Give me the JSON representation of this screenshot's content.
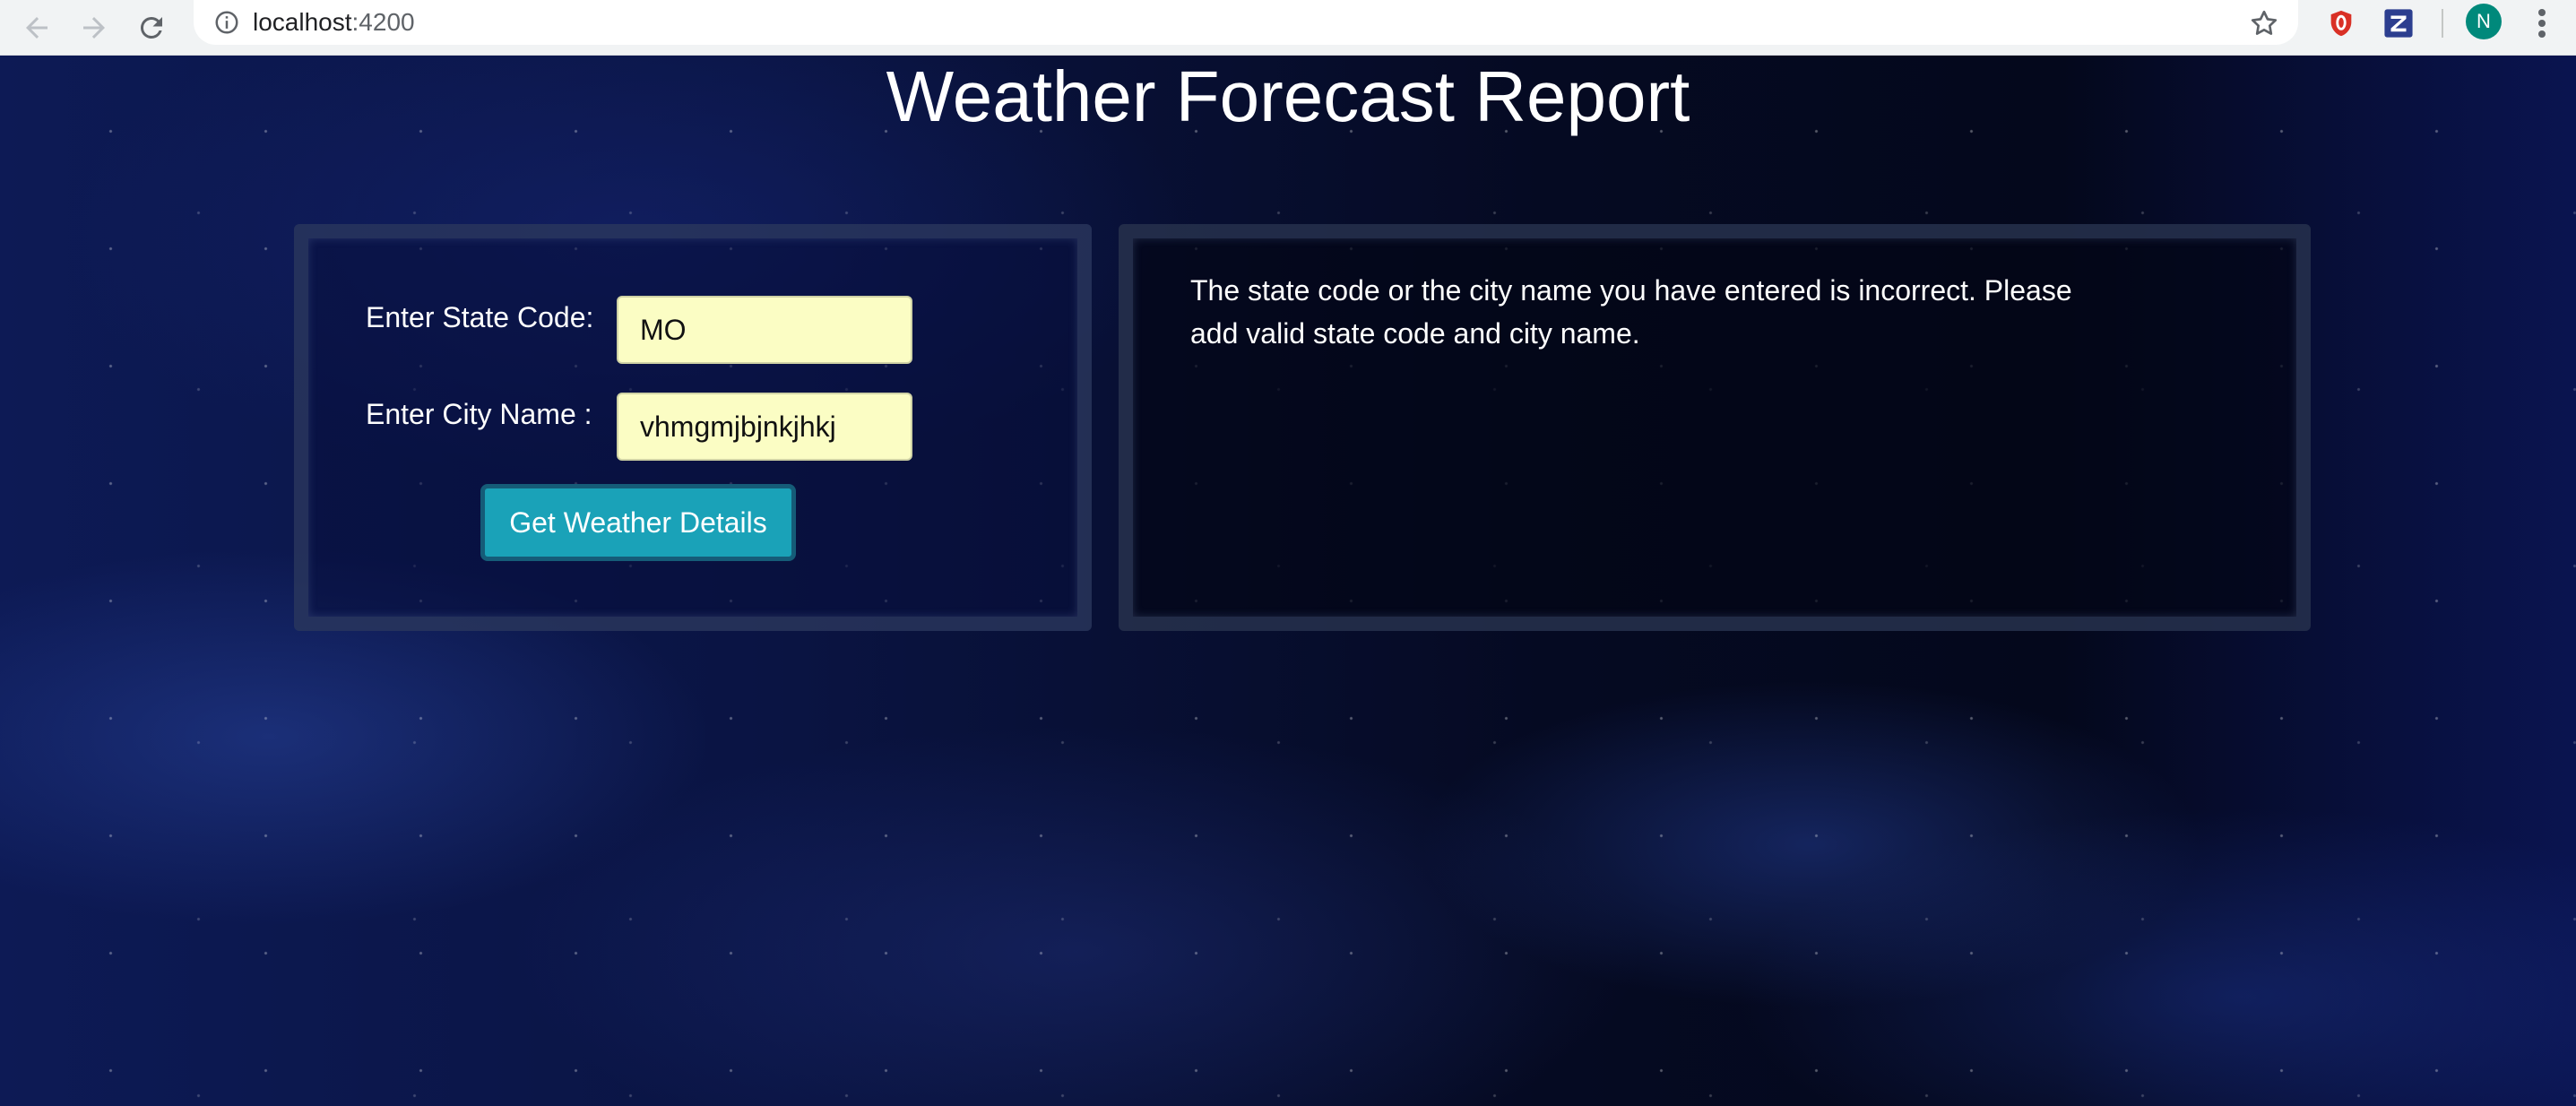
{
  "browser": {
    "url_host": "localhost",
    "url_port": ":4200",
    "avatar_initial": "N",
    "extensions": [
      {
        "name": "opera-shield-icon",
        "color": "#d93025"
      },
      {
        "name": "zotero-z-icon",
        "color": "#2c3e8f"
      }
    ]
  },
  "page": {
    "title": "Weather Forecast Report"
  },
  "form": {
    "state_label": "Enter State Code:",
    "state_value": "MO",
    "city_label": "Enter City Name :",
    "city_value": "vhmgmjbjnkjhkj",
    "submit_label": "Get Weather Details"
  },
  "result": {
    "message": "The state code or the city name you have entered is incorrect. Please add valid state code and city name."
  },
  "colors": {
    "input_background": "#fbfdc4",
    "button_background": "#1aa2b8",
    "avatar_background": "#00897b"
  }
}
